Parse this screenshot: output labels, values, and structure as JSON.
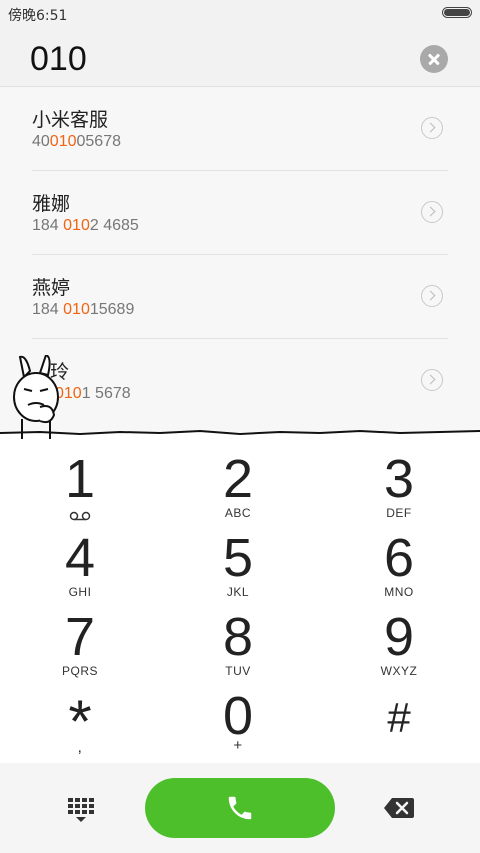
{
  "status_bar": {
    "time": "傍晚6:51",
    "battery_icon": "battery-icon"
  },
  "search": {
    "query": "010",
    "clear_icon": "clear-icon"
  },
  "highlight_color": "#f06412",
  "results": [
    {
      "name": "小米客服",
      "number_parts": [
        "40",
        "010",
        "05678"
      ]
    },
    {
      "name": "雅娜",
      "number_parts": [
        "184 ",
        "010",
        "2 4685"
      ]
    },
    {
      "name": "燕婷",
      "number_parts": [
        "184 ",
        "010",
        "15689"
      ]
    },
    {
      "name": "玲",
      "number_parts": [
        "",
        "010",
        "1 5678"
      ]
    }
  ],
  "keypad": [
    {
      "digit": "1",
      "letters": ""
    },
    {
      "digit": "2",
      "letters": "ABC"
    },
    {
      "digit": "3",
      "letters": "DEF"
    },
    {
      "digit": "4",
      "letters": "GHI"
    },
    {
      "digit": "5",
      "letters": "JKL"
    },
    {
      "digit": "6",
      "letters": "MNO"
    },
    {
      "digit": "7",
      "letters": "PQRS"
    },
    {
      "digit": "8",
      "letters": "TUV"
    },
    {
      "digit": "9",
      "letters": "WXYZ"
    },
    {
      "digit": "*",
      "letters": ","
    },
    {
      "digit": "0",
      "letters": "+"
    },
    {
      "digit": "#",
      "letters": ""
    }
  ],
  "bottom_bar": {
    "dialpad_icon": "dialpad-grid-icon",
    "call_icon": "phone-icon",
    "call_color": "#4cbf2a",
    "delete_icon": "backspace-icon"
  }
}
